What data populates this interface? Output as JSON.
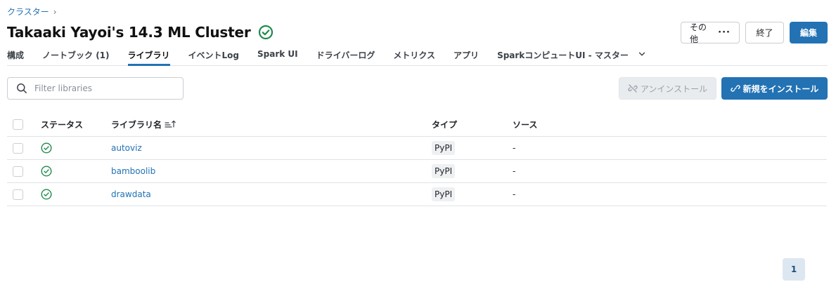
{
  "breadcrumb": {
    "parent": "クラスター",
    "separator": "›"
  },
  "page": {
    "title": "Takaaki Yayoi's 14.3 ML Cluster",
    "status_icon": "check-circle-icon"
  },
  "actions": {
    "more_label": "その他",
    "more_icon": "ellipsis-icon",
    "terminate_label": "終了",
    "edit_label": "編集"
  },
  "tabs": [
    {
      "label": "構成"
    },
    {
      "label": "ノートブック (1)"
    },
    {
      "label": "ライブラリ",
      "active": true
    },
    {
      "label": "イベントLog"
    },
    {
      "label": "Spark UI"
    },
    {
      "label": "ドライバーログ"
    },
    {
      "label": "メトリクス"
    },
    {
      "label": "アプリ"
    },
    {
      "label": "SparkコンピュートUI - マスター"
    }
  ],
  "toolbar": {
    "search_placeholder": "Filter libraries",
    "uninstall_label": "アンインストール",
    "install_label": "新規をインストール"
  },
  "table": {
    "columns": {
      "status": "ステータス",
      "name": "ライブラリ名",
      "type": "タイプ",
      "source": "ソース"
    },
    "rows": [
      {
        "name": "autoviz",
        "type": "PyPI",
        "source": "-"
      },
      {
        "name": "bamboolib",
        "type": "PyPI",
        "source": "-"
      },
      {
        "name": "drawdata",
        "type": "PyPI",
        "source": "-"
      }
    ]
  },
  "pagination": {
    "current": "1"
  },
  "colors": {
    "accent": "#2272b4",
    "success": "#1f8a4c"
  }
}
